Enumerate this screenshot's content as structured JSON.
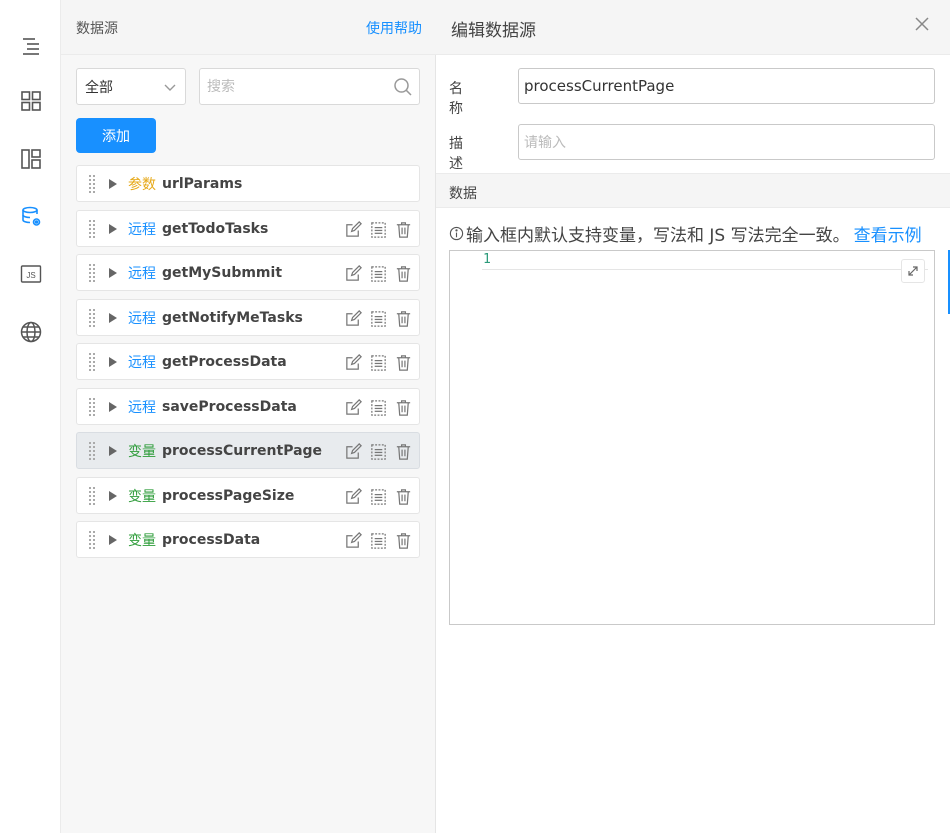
{
  "rail": {
    "icons": [
      "outline-icon",
      "components-icon",
      "layout-icon",
      "datasource-icon",
      "js-icon",
      "globe-icon"
    ],
    "active_index": 3,
    "active_color": "#1890ff"
  },
  "list_panel": {
    "title": "数据源",
    "help_link": "使用帮助",
    "filter": {
      "value": "全部"
    },
    "search": {
      "placeholder": "搜索"
    },
    "add_label": "添加",
    "items": [
      {
        "type_label": "参数",
        "type_color": "#e6a817",
        "name": "urlParams",
        "has_actions": false,
        "selected": false
      },
      {
        "type_label": "远程",
        "type_color": "#1890ff",
        "name": "getTodoTasks",
        "has_actions": true,
        "selected": false
      },
      {
        "type_label": "远程",
        "type_color": "#1890ff",
        "name": "getMySubmmit",
        "has_actions": true,
        "selected": false
      },
      {
        "type_label": "远程",
        "type_color": "#1890ff",
        "name": "getNotifyMeTasks",
        "has_actions": true,
        "selected": false
      },
      {
        "type_label": "远程",
        "type_color": "#1890ff",
        "name": "getProcessData",
        "has_actions": true,
        "selected": false
      },
      {
        "type_label": "远程",
        "type_color": "#1890ff",
        "name": "saveProcessData",
        "has_actions": true,
        "selected": false
      },
      {
        "type_label": "变量",
        "type_color": "#2e9c3a",
        "name": "processCurrentPage",
        "has_actions": true,
        "selected": true
      },
      {
        "type_label": "变量",
        "type_color": "#2e9c3a",
        "name": "processPageSize",
        "has_actions": true,
        "selected": false
      },
      {
        "type_label": "变量",
        "type_color": "#2e9c3a",
        "name": "processData",
        "has_actions": true,
        "selected": false
      }
    ]
  },
  "edit_panel": {
    "title": "编辑数据源",
    "name_label": "名称",
    "name_value": "processCurrentPage",
    "desc_label": "描述",
    "desc_placeholder": "请输入",
    "data_section": "数据",
    "tip_text": "输入框内默认支持变量，写法和 JS 写法完全一致。",
    "tip_link": "查看示例",
    "editor": {
      "line_number": "1",
      "content": ""
    }
  }
}
